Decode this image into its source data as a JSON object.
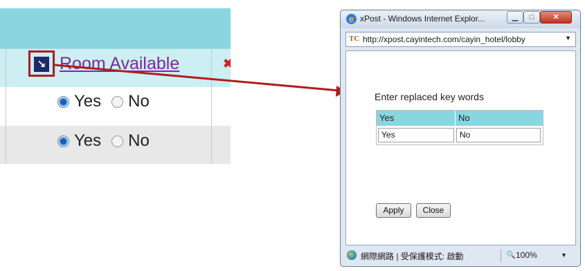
{
  "left_table": {
    "column_header": "Room Available",
    "sort_icon": "sort-arrow-icon",
    "delete_icon": "delete-x-icon",
    "rows": [
      {
        "yes_label": "Yes",
        "no_label": "No",
        "selected": "Yes"
      },
      {
        "yes_label": "Yes",
        "no_label": "No",
        "selected": "Yes"
      }
    ]
  },
  "popup": {
    "title": "xPost - Windows Internet Explor...",
    "url": "http://xpost.cayintech.com/cayin_hotel/lobby",
    "heading": "Enter replaced key words",
    "table": {
      "headers": [
        "Yes",
        "No"
      ],
      "values": [
        "Yes",
        "No"
      ]
    },
    "apply_label": "Apply",
    "close_label": "Close",
    "status_text": "網際網路 | 受保護模式: 啟動",
    "zoom": "100%"
  },
  "colors": {
    "header_bg": "#8ad6e0",
    "highlight_red": "#b01c1c",
    "link_purple": "#7b2a9c"
  }
}
